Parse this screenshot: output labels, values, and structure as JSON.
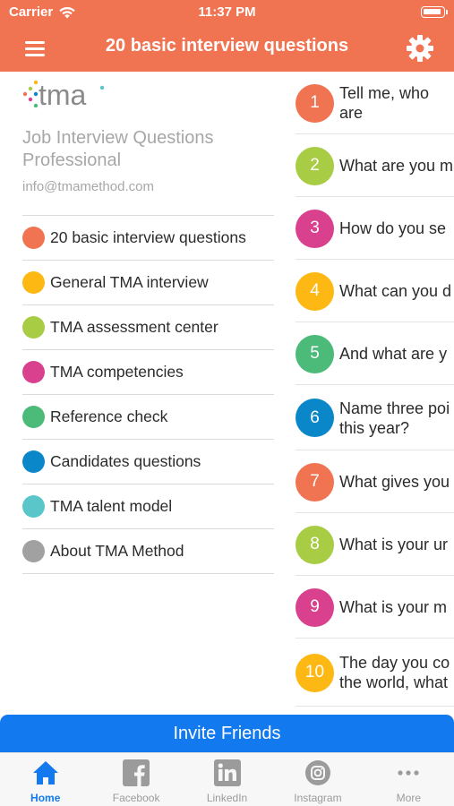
{
  "status_bar": {
    "carrier": "Carrier",
    "time": "11:37 PM"
  },
  "header": {
    "title": "20 basic interview questions",
    "background": "#f07452"
  },
  "drawer": {
    "logo_text": "tma",
    "app_name": "Job Interview Questions Professional",
    "email": "info@tmamethod.com",
    "items": [
      {
        "label": "20 basic interview questions",
        "color": "#f07452"
      },
      {
        "label": "General TMA interview",
        "color": "#fdb813"
      },
      {
        "label": "TMA assessment center",
        "color": "#a8cc44"
      },
      {
        "label": "TMA competencies",
        "color": "#d9418f"
      },
      {
        "label": "Reference check",
        "color": "#4cba78"
      },
      {
        "label": "Candidates questions",
        "color": "#0a87c9"
      },
      {
        "label": "TMA talent model",
        "color": "#5bc6c9"
      },
      {
        "label": "About TMA Method",
        "color": "#a1a1a1"
      }
    ]
  },
  "questions": [
    {
      "number": "1",
      "text": "Tell me, who are",
      "color": "#f07452"
    },
    {
      "number": "2",
      "text": "What are you m",
      "color": "#a8cc44"
    },
    {
      "number": "3",
      "text": "How do you se",
      "color": "#d9418f"
    },
    {
      "number": "4",
      "text": "What can you d",
      "color": "#fdb813"
    },
    {
      "number": "5",
      "text": "And what are y",
      "color": "#4cba78"
    },
    {
      "number": "6",
      "text": "Name three poi\nthis year?",
      "color": "#0a87c9"
    },
    {
      "number": "7",
      "text": "What gives you",
      "color": "#f07452"
    },
    {
      "number": "8",
      "text": "What is your ur",
      "color": "#a8cc44"
    },
    {
      "number": "9",
      "text": "What is your m",
      "color": "#d9418f"
    },
    {
      "number": "10",
      "text": "The day you co\nthe world, what",
      "color": "#fdb813"
    }
  ],
  "invite_button": {
    "label": "Invite Friends",
    "color": "#1279ef"
  },
  "tab_bar": {
    "tabs": [
      {
        "label": "Home",
        "icon": "home-icon"
      },
      {
        "label": "Facebook",
        "icon": "facebook-icon"
      },
      {
        "label": "LinkedIn",
        "icon": "linkedin-icon"
      },
      {
        "label": "Instagram",
        "icon": "instagram-icon"
      },
      {
        "label": "More",
        "icon": "more-icon"
      }
    ],
    "active_color": "#1279ef",
    "inactive_color": "#9b9b9b"
  }
}
